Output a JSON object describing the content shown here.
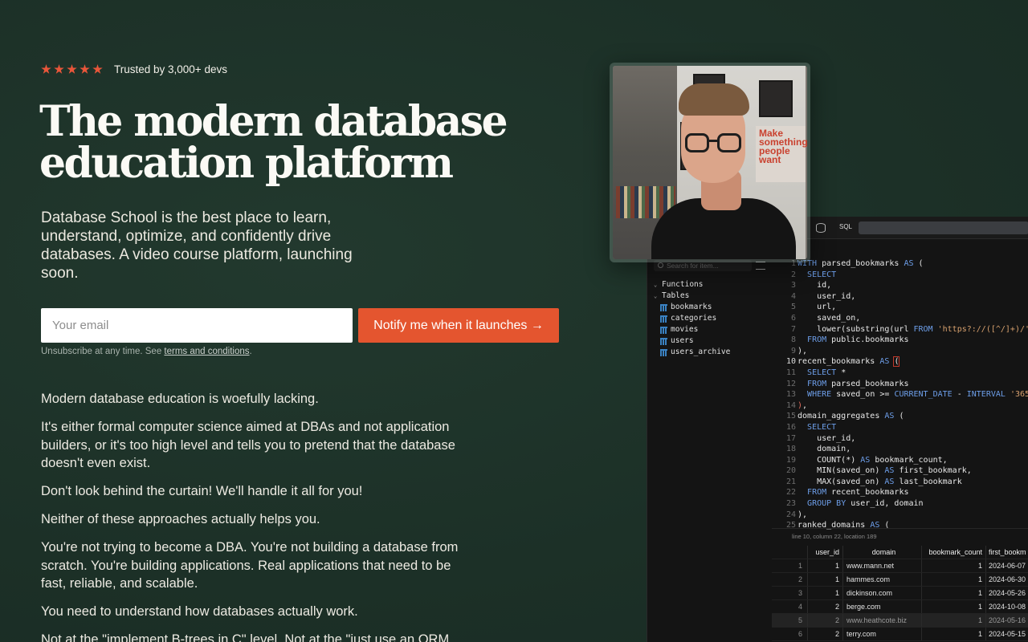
{
  "hero": {
    "trust_text": "Trusted by 3,000+ devs",
    "rating_stars": 5,
    "headline_line1": "The modern database",
    "headline_line2": "education platform",
    "subtitle": "Database School is the best place to learn, understand, optimize, and confidently drive databases. A video course platform, launching soon."
  },
  "form": {
    "email_placeholder": "Your email",
    "notify_label": "Notify me when it launches →",
    "fine_print": "Unsubscribe at any time. See ",
    "terms_link": "terms and conditions",
    "fine_print_end": "."
  },
  "body_paragraphs": [
    "Modern database education is woefully lacking.",
    "It's either formal computer science aimed at DBAs and not application builders, or it's too high level and tells you to pretend that the database doesn't even exist.",
    "Don't look behind the curtain! We'll handle it all for you!",
    "Neither of these approaches actually helps you.",
    "You're not trying to become a DBA. You're not building a database from scratch. You're building applications. Real applications that need to be fast, reliable, and scalable.",
    "You need to understand how databases actually work.",
    "Not at the \"implement B-trees in C\" level. Not at the \"just use an ORM"
  ],
  "editor": {
    "tab_label": "SQL",
    "search_placeholder": "Search for item...",
    "tree": {
      "functions": "Functions",
      "tables": "Tables",
      "table_items": [
        "bookmarks",
        "categories",
        "movies",
        "users",
        "users_archive"
      ]
    },
    "line_numbers": [
      "1",
      "2",
      "3",
      "4",
      "5",
      "6",
      "7",
      "8",
      "9",
      "10",
      "11",
      "12",
      "13",
      "14",
      "15",
      "16",
      "17",
      "18",
      "19",
      "20",
      "21",
      "22",
      "23",
      "24",
      "25"
    ],
    "status": "line 10, column 22, location 189",
    "results": {
      "headers": [
        "",
        "user_id",
        "domain",
        "bookmark_count",
        "first_bookm"
      ],
      "rows": [
        [
          "1",
          "1",
          "www.mann.net",
          "1",
          "2024-06-07"
        ],
        [
          "2",
          "1",
          "hammes.com",
          "1",
          "2024-06-30"
        ],
        [
          "3",
          "1",
          "dickinson.com",
          "1",
          "2024-05-26"
        ],
        [
          "4",
          "2",
          "berge.com",
          "1",
          "2024-10-08"
        ],
        [
          "5",
          "2",
          "www.heathcote.biz",
          "1",
          "2024-05-16"
        ],
        [
          "6",
          "2",
          "terry.com",
          "1",
          "2024-05-15"
        ]
      ]
    }
  },
  "video": {
    "poster_text": "Make something people want"
  },
  "colors": {
    "background": "#1e3329",
    "accent": "#e4552f",
    "star": "#e9563a",
    "sql_keyword": "#6d9ee9",
    "sql_string": "#d8a16e"
  }
}
